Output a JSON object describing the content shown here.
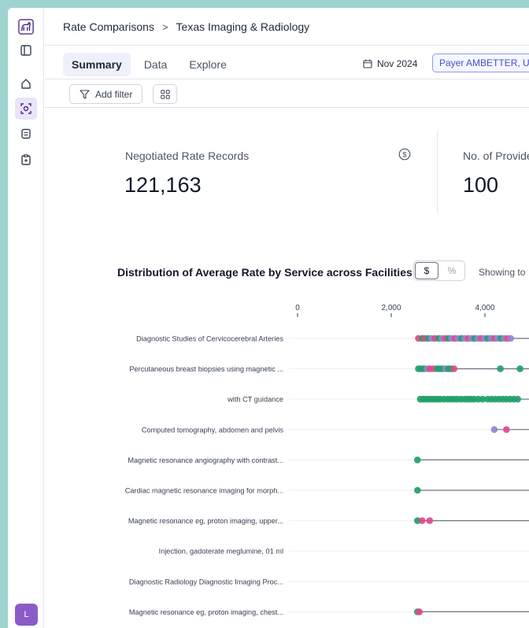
{
  "breadcrumb": {
    "parent": "Rate Comparisons",
    "separator": ">",
    "current": "Texas Imaging & Radiology"
  },
  "tabs": [
    {
      "label": "Summary"
    },
    {
      "label": "Data"
    },
    {
      "label": "Explore"
    }
  ],
  "date_filter": "Nov 2024",
  "payer_filter": "Payer AMBETTER, UI",
  "toolbar": {
    "add_filter_label": "Add filter"
  },
  "cards": {
    "records": {
      "label": "Negotiated Rate Records",
      "value": "121,163"
    },
    "providers": {
      "label": "No. of Provider",
      "value": "100"
    }
  },
  "chart_section": {
    "title": "Distribution of Average Rate by Service across Facilities",
    "toggle": [
      "$",
      "%"
    ],
    "showing_label": "Showing to"
  },
  "avatar": {
    "initial": "L"
  },
  "colors": {
    "accent": "#4b2a8a",
    "green": "#22a06b",
    "pink": "#e0498c",
    "purple": "#9385d6"
  },
  "chart_data": {
    "type": "scatter",
    "x_ticks": [
      "0",
      "2,000",
      "4,000"
    ],
    "xlim": [
      0,
      5200
    ],
    "categories": [
      "Diagnostic Studies of Cervicocerebral Arteries",
      "Percutaneous breast biopsies using magnetic ...",
      "with CT guidance",
      "Computed tomography, abdomen and pelvis",
      "Magnetic resonance angiography with contrast...",
      "Cardiac magnetic resonance imaging for morph...",
      "Magnetic resonance eg, proton imaging, upper...",
      "Injection, gadoterate meglumine, 01 ml",
      "Diagnostic Radiology Diagnostic Imaging Proc...",
      "Magnetic resonance eg, proton imaging, chest..."
    ],
    "rows": [
      {
        "line_from": 2550,
        "points": [
          {
            "x": 2580,
            "c": "p"
          },
          {
            "x": 2660,
            "c": "g"
          },
          {
            "x": 2720,
            "c": "p"
          },
          {
            "x": 2790,
            "c": "g"
          },
          {
            "x": 2860,
            "c": "k"
          },
          {
            "x": 2930,
            "c": "p"
          },
          {
            "x": 3010,
            "c": "g"
          },
          {
            "x": 3080,
            "c": "k"
          },
          {
            "x": 3150,
            "c": "p"
          },
          {
            "x": 3220,
            "c": "g"
          },
          {
            "x": 3290,
            "c": "k"
          },
          {
            "x": 3360,
            "c": "p"
          },
          {
            "x": 3430,
            "c": "k"
          },
          {
            "x": 3500,
            "c": "g"
          },
          {
            "x": 3570,
            "c": "k"
          },
          {
            "x": 3640,
            "c": "p"
          },
          {
            "x": 3710,
            "c": "k"
          },
          {
            "x": 3780,
            "c": "g"
          },
          {
            "x": 3850,
            "c": "k"
          },
          {
            "x": 3920,
            "c": "p"
          },
          {
            "x": 3990,
            "c": "k"
          },
          {
            "x": 4060,
            "c": "g"
          },
          {
            "x": 4130,
            "c": "k"
          },
          {
            "x": 4200,
            "c": "p"
          },
          {
            "x": 4270,
            "c": "k"
          },
          {
            "x": 4340,
            "c": "g"
          },
          {
            "x": 4410,
            "c": "k"
          },
          {
            "x": 4480,
            "c": "p"
          },
          {
            "x": 4550,
            "c": "k"
          }
        ]
      },
      {
        "line_from": 2560,
        "points": [
          {
            "x": 2580,
            "c": "g"
          },
          {
            "x": 2640,
            "c": "g"
          },
          {
            "x": 2700,
            "c": "g"
          },
          {
            "x": 2770,
            "c": "k"
          },
          {
            "x": 2830,
            "c": "p"
          },
          {
            "x": 2910,
            "c": "p"
          },
          {
            "x": 2980,
            "c": "g"
          },
          {
            "x": 3040,
            "c": "g"
          },
          {
            "x": 3100,
            "c": "g"
          },
          {
            "x": 3160,
            "c": "k"
          },
          {
            "x": 3220,
            "c": "g"
          },
          {
            "x": 3280,
            "c": "g"
          },
          {
            "x": 3340,
            "c": "p"
          },
          {
            "x": 4330,
            "c": "g"
          },
          {
            "x": 4750,
            "c": "g"
          }
        ]
      },
      {
        "line_from": 2600,
        "points": [
          {
            "x": 2620,
            "c": "g"
          },
          {
            "x": 2680,
            "c": "g"
          },
          {
            "x": 2740,
            "c": "g"
          },
          {
            "x": 2800,
            "c": "g"
          },
          {
            "x": 2860,
            "c": "g"
          },
          {
            "x": 2920,
            "c": "g"
          },
          {
            "x": 2980,
            "c": "g"
          },
          {
            "x": 3040,
            "c": "g"
          },
          {
            "x": 3120,
            "c": "g"
          },
          {
            "x": 3200,
            "c": "g"
          },
          {
            "x": 3270,
            "c": "g"
          },
          {
            "x": 3340,
            "c": "g"
          },
          {
            "x": 3410,
            "c": "g"
          },
          {
            "x": 3490,
            "c": "g"
          },
          {
            "x": 3570,
            "c": "g"
          },
          {
            "x": 3640,
            "c": "g"
          },
          {
            "x": 3700,
            "c": "g"
          },
          {
            "x": 3770,
            "c": "g"
          },
          {
            "x": 3860,
            "c": "g"
          },
          {
            "x": 3950,
            "c": "g"
          },
          {
            "x": 4060,
            "c": "g"
          },
          {
            "x": 4140,
            "c": "g"
          },
          {
            "x": 4220,
            "c": "g"
          },
          {
            "x": 4300,
            "c": "g"
          },
          {
            "x": 4380,
            "c": "g"
          },
          {
            "x": 4460,
            "c": "g"
          },
          {
            "x": 4540,
            "c": "g"
          },
          {
            "x": 4620,
            "c": "g"
          },
          {
            "x": 4700,
            "c": "g"
          }
        ]
      },
      {
        "line_from": 4200,
        "points": [
          {
            "x": 4200,
            "c": "k"
          },
          {
            "x": 4460,
            "c": "p"
          }
        ]
      },
      {
        "line_from": 2560,
        "points": [
          {
            "x": 2560,
            "c": "g"
          }
        ]
      },
      {
        "line_from": 2560,
        "points": [
          {
            "x": 2560,
            "c": "g"
          }
        ]
      },
      {
        "line_from": 2560,
        "points": [
          {
            "x": 2560,
            "c": "g"
          },
          {
            "x": 2660,
            "c": "p"
          },
          {
            "x": 2820,
            "c": "p"
          }
        ]
      },
      {
        "line_from": null,
        "points": []
      },
      {
        "line_from": null,
        "points": []
      },
      {
        "line_from": 2560,
        "points": [
          {
            "x": 2560,
            "c": "g"
          },
          {
            "x": 2600,
            "c": "p"
          }
        ]
      }
    ]
  }
}
